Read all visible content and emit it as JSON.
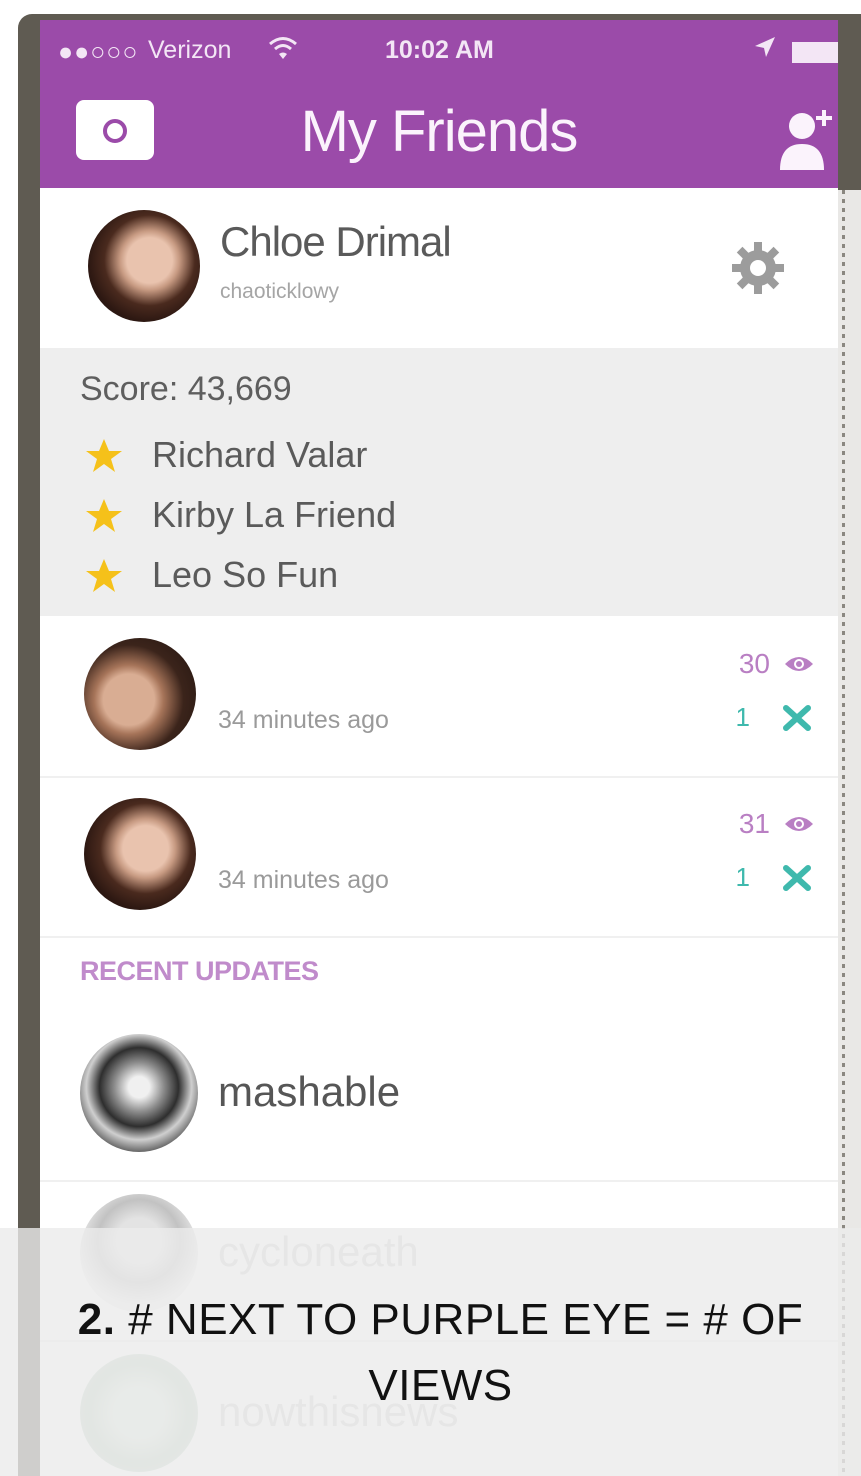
{
  "status_bar": {
    "signal": "●●○○○",
    "carrier": "Verizon",
    "time": "10:02 AM"
  },
  "nav": {
    "title": "My Friends"
  },
  "profile": {
    "name": "Chloe Drimal",
    "username": "chaoticklowy"
  },
  "best_friends": {
    "score": "Score: 43,669",
    "names": [
      "Richard Valar",
      "Kirby La Friend",
      "Leo So Fun"
    ]
  },
  "stories": [
    {
      "time": "34 minutes ago",
      "views": "30",
      "screenshots": "1"
    },
    {
      "time": "34 minutes ago",
      "views": "31",
      "screenshots": "1"
    }
  ],
  "recent_updates": {
    "header": "RECENT UPDATES",
    "items": [
      "mashable",
      "cycloneath",
      "nowthisnews"
    ]
  },
  "caption": {
    "step": "2.",
    "text": "# NEXT TO PURPLE EYE = # OF VIEWS"
  },
  "colors": {
    "accent_purple": "#9b4ba9",
    "views_purple": "#b97fc3",
    "screenshot_teal": "#3fb9ad",
    "star_yellow": "#f5c11a"
  },
  "icons": [
    "camera-icon",
    "add-friend-icon",
    "gear-icon",
    "star-icon",
    "eye-icon",
    "screenshot-icon",
    "wifi-icon",
    "location-icon",
    "battery-icon"
  ]
}
